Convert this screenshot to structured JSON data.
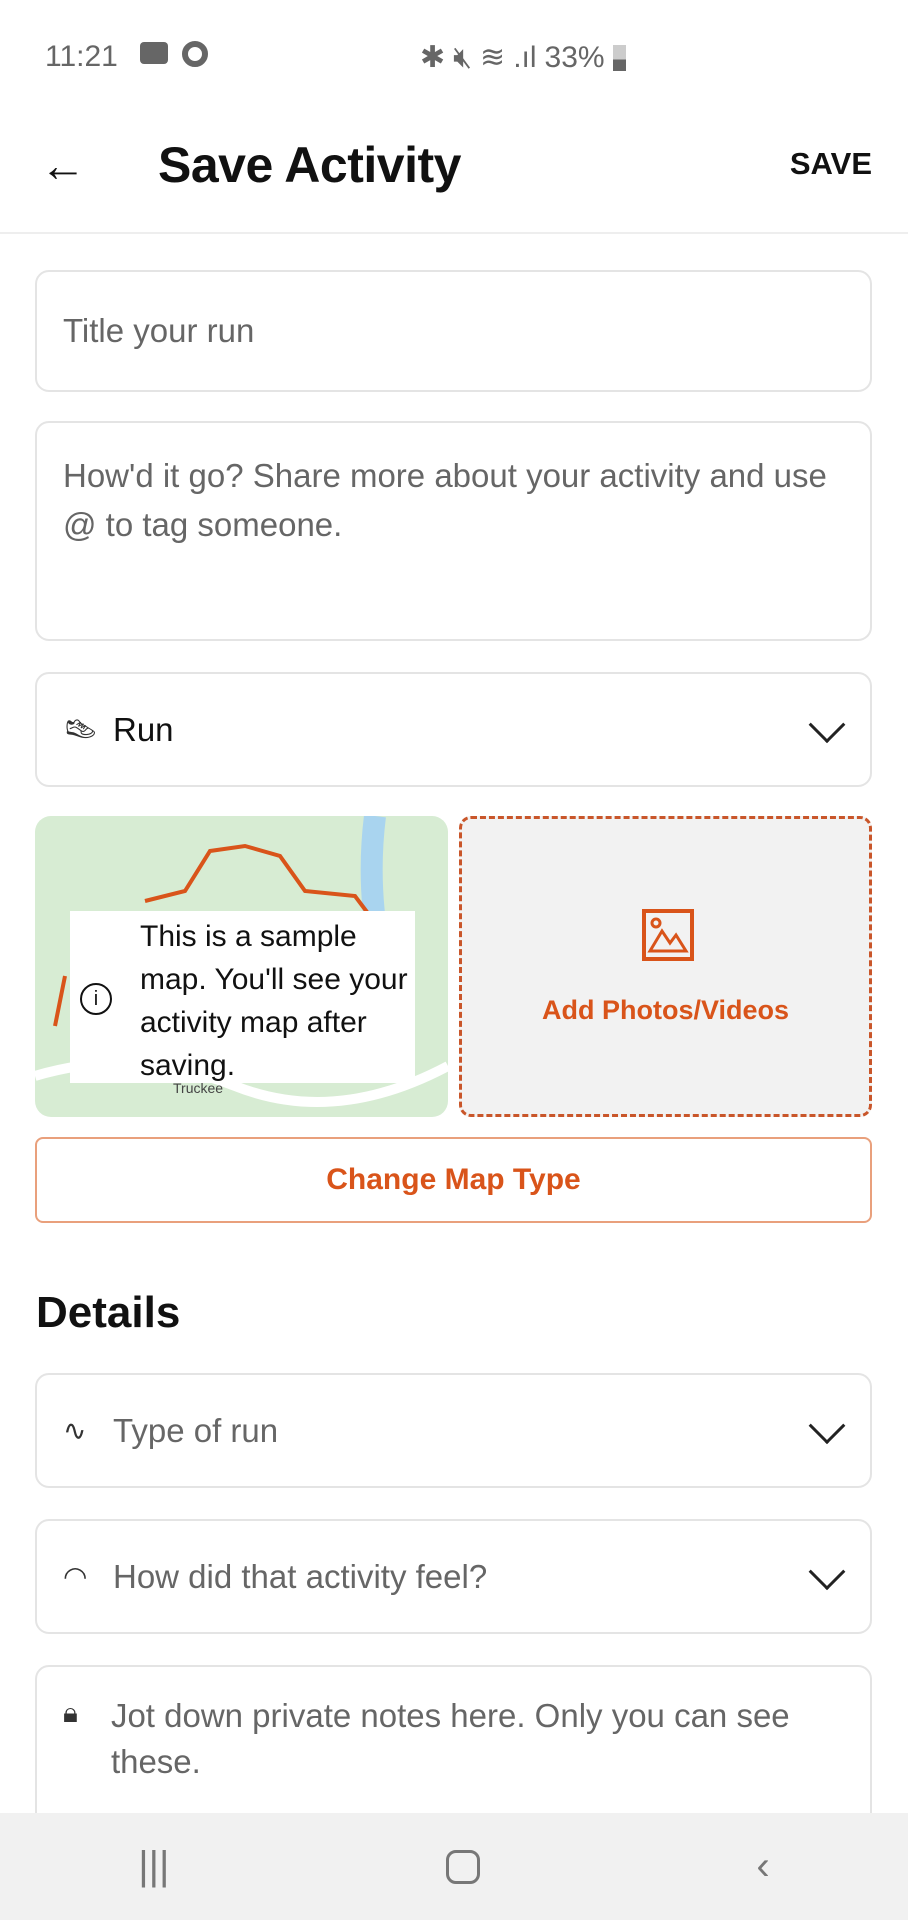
{
  "status_bar": {
    "time": "11:21",
    "battery": "33%",
    "icons": [
      "video-record-icon",
      "circle-icon",
      "bluetooth-icon",
      "mute-icon",
      "wifi-icon",
      "signal-icon",
      "battery-icon"
    ]
  },
  "header": {
    "title": "Save Activity",
    "save_label": "SAVE"
  },
  "form": {
    "title_placeholder": "Title your run",
    "description_placeholder": "How'd it go? Share more about your activity and use @ to tag someone.",
    "activity_type": "Run"
  },
  "map": {
    "notice": "This is a sample map. You'll see your activity map after saving.",
    "place_label": "Truckee"
  },
  "photos": {
    "label": "Add Photos/Videos"
  },
  "change_map_type": "Change Map Type",
  "details": {
    "heading": "Details",
    "type_of_run": "Type of run",
    "feel": "How did that activity feel?",
    "private_notes_placeholder": "Jot down private notes here. Only you can see these."
  },
  "colors": {
    "accent": "#d9541a",
    "border": "#e4e4e4"
  }
}
